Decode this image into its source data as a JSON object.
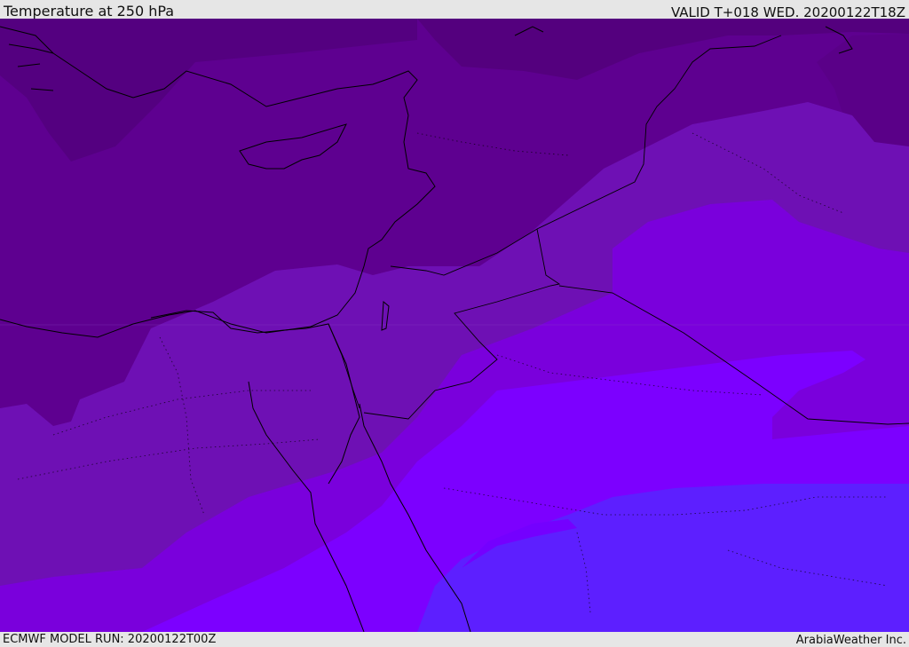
{
  "header": {
    "title": "Temperature at 250 hPa",
    "valid": "VALID T+018 WED. 20200122T18Z"
  },
  "footer": {
    "model_run": "ECMWF MODEL RUN: 20200122T00Z",
    "credit": "ArabiaWeather Inc."
  },
  "map": {
    "field": "temperature",
    "level": "250 hPa",
    "shading_colors": [
      "#520078",
      "#5e0090",
      "#6c00a8",
      "#7810b8",
      "#7a00d0",
      "#7c00ff",
      "#5d1fff"
    ],
    "land_border_color": "#000000"
  }
}
